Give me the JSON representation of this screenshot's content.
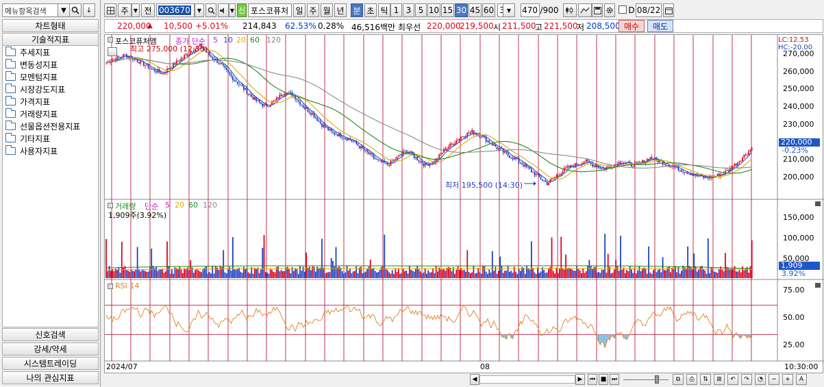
{
  "left_panel": {
    "search_placeholder": "메뉴항목검색",
    "chart_type_label": "차트형태",
    "tech_indicator_label": "기술적지표",
    "folders": [
      "추세지표",
      "변동성지표",
      "모멘텀지표",
      "시장강도지표",
      "가격지표",
      "거래량지표",
      "선물옵션전용지표",
      "기타지표",
      "사용자지표"
    ],
    "bottom_buttons": [
      "신호검색",
      "강세/약세",
      "시스템트레이딩",
      "나의 관심지표"
    ]
  },
  "toolbar": {
    "period_sel": "주",
    "prev_label": "전",
    "code": "003670",
    "badge": "신",
    "stock_name": "포스코퓨처",
    "period_buttons": [
      "일",
      "주",
      "월",
      "년",
      "분",
      "초",
      "틱"
    ],
    "active_period": "분",
    "interval_buttons": [
      "1",
      "3",
      "5",
      "10",
      "15",
      "30",
      "45",
      "60"
    ],
    "active_interval": "30",
    "interval_value": "30",
    "count": "470",
    "count_total": "/900",
    "date_label": "D",
    "date": "08/22"
  },
  "quote": {
    "price": "220,000",
    "change_arrow": "▲",
    "change": "10,500",
    "change_pct": "+5.01%",
    "volume": "214,843",
    "ratio": "62.53%",
    "ratio2": "0.28%",
    "amount": "46,516백만",
    "best_label": "최우선",
    "best_ask": "220,000",
    "best_bid": "219,500",
    "open_label": "시",
    "open": "211,500",
    "high_label": "고",
    "high": "221,500",
    "low_label": "저",
    "low": "208,500",
    "buy_label": "매수",
    "sell_label": "매도"
  },
  "chart": {
    "price_legend": {
      "name": "포스코퓨처엠",
      "type": "종가 단순",
      "ma": [
        "5",
        "10",
        "20",
        "60",
        "120"
      ]
    },
    "high_note": "최고 275,000 (12:30)",
    "low_note": "최저 195,500 (14:30)",
    "lc": "LC:12.53",
    "hc": "HC:-20.00",
    "price_ticks": [
      "270,000",
      "260,000",
      "250,000",
      "240,000",
      "230,000",
      "220,000",
      "210,000",
      "200,000"
    ],
    "current_price_tag": "220,000",
    "current_pct_tag": "-0.23%",
    "volume_legend": {
      "name": "거래량",
      "type": "단순",
      "ma": [
        "5",
        "20",
        "60",
        "120"
      ]
    },
    "volume_value": "1,909주(3.92%)",
    "volume_ticks": [
      "150,000",
      "100,000",
      "50,000"
    ],
    "volume_tag": "1,909",
    "volume_pct_tag": "3.92%",
    "rsi_legend": "RSI 14",
    "rsi_ticks": [
      "75.00",
      "50.00",
      "25.00"
    ],
    "x_labels": [
      "2024/07",
      "08"
    ],
    "time_label": "10:30:00",
    "colors": {
      "ma5": "#e060e0",
      "ma10": "#1f56c8",
      "ma20": "#e0a800",
      "ma60": "#1a8a1a",
      "ma120": "#8a8a8a",
      "up": "#e0001b",
      "down": "#1f3fbf",
      "rsi": "#e08020",
      "grid_v": "#b00020"
    }
  },
  "chart_data": {
    "type": "line",
    "title": "포스코퓨처엠",
    "series": [
      {
        "name": "포스코퓨처엠",
        "type": "candlestick-approx",
        "values": [
          266000,
          268000,
          270000,
          268000,
          265000,
          262000,
          260000,
          264000,
          268000,
          272000,
          275000,
          270000,
          266000,
          260000,
          255000,
          250000,
          245000,
          242000,
          245000,
          250000,
          248000,
          242000,
          238000,
          232000,
          228000,
          226000,
          224000,
          220000,
          216000,
          212000,
          210000,
          214000,
          218000,
          214000,
          210000,
          212000,
          218000,
          222000,
          226000,
          228000,
          226000,
          222000,
          218000,
          215000,
          212000,
          208000,
          204000,
          200000,
          204000,
          208000,
          210000,
          212000,
          210000,
          208000,
          210000,
          212000,
          210000,
          211000,
          214000,
          212000,
          210000,
          208000,
          206000,
          204000,
          203000,
          204000,
          206000,
          210000,
          215000,
          220000
        ]
      }
    ],
    "annotations": [
      "최고 275,000 (12:30)",
      "최저 195,500 (14:30)"
    ],
    "ylim": [
      195000,
      278000
    ]
  }
}
